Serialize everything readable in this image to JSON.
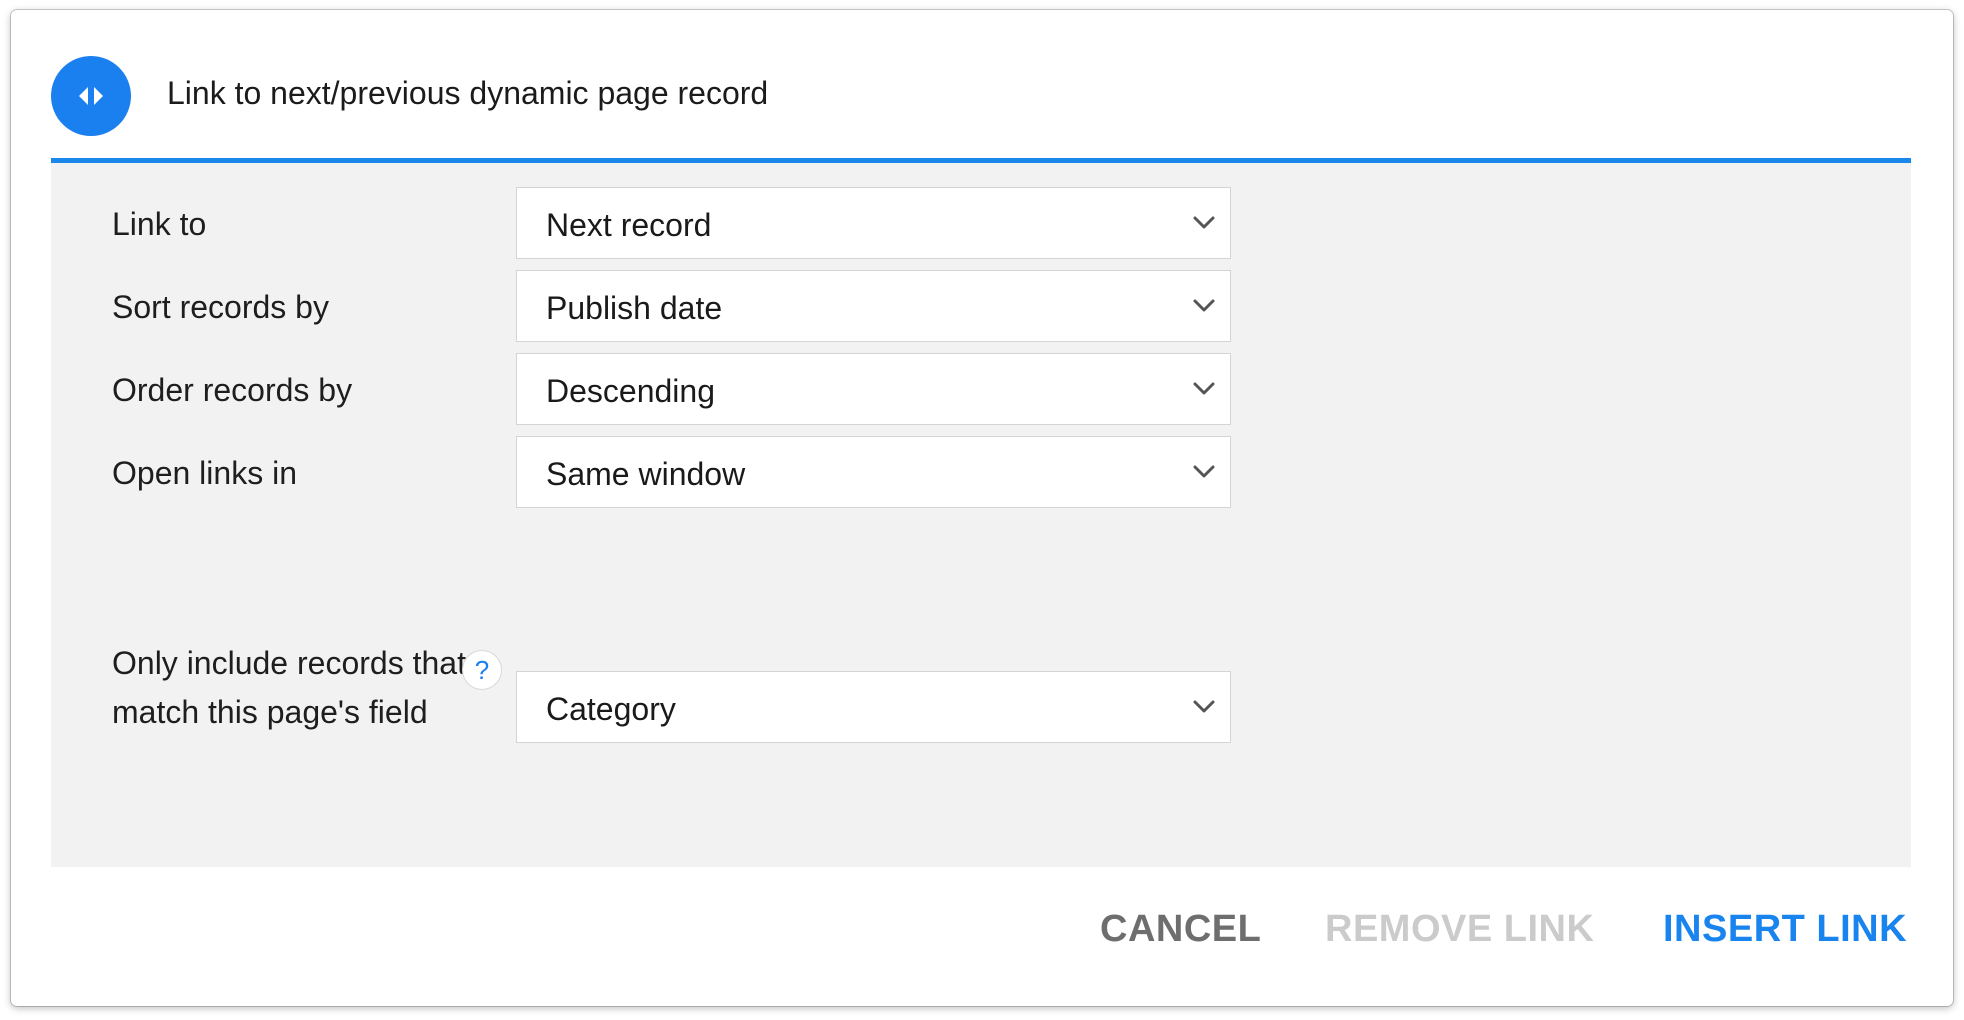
{
  "header": {
    "title": "Link to next/previous dynamic page record",
    "icon": "arrows-left-right-icon",
    "accent_color": "#1a7fef"
  },
  "fields": [
    {
      "label": "Link to",
      "value": "Next record"
    },
    {
      "label": "Sort records by",
      "value": "Publish date"
    },
    {
      "label": "Order records by",
      "value": "Descending"
    },
    {
      "label": "Open links in",
      "value": "Same window"
    },
    {
      "label": "Only include records that match this page's field",
      "value": "Category",
      "help_icon": "?"
    }
  ],
  "buttons": {
    "cancel": "CANCEL",
    "remove": "REMOVE LINK",
    "insert": "INSERT LINK"
  }
}
